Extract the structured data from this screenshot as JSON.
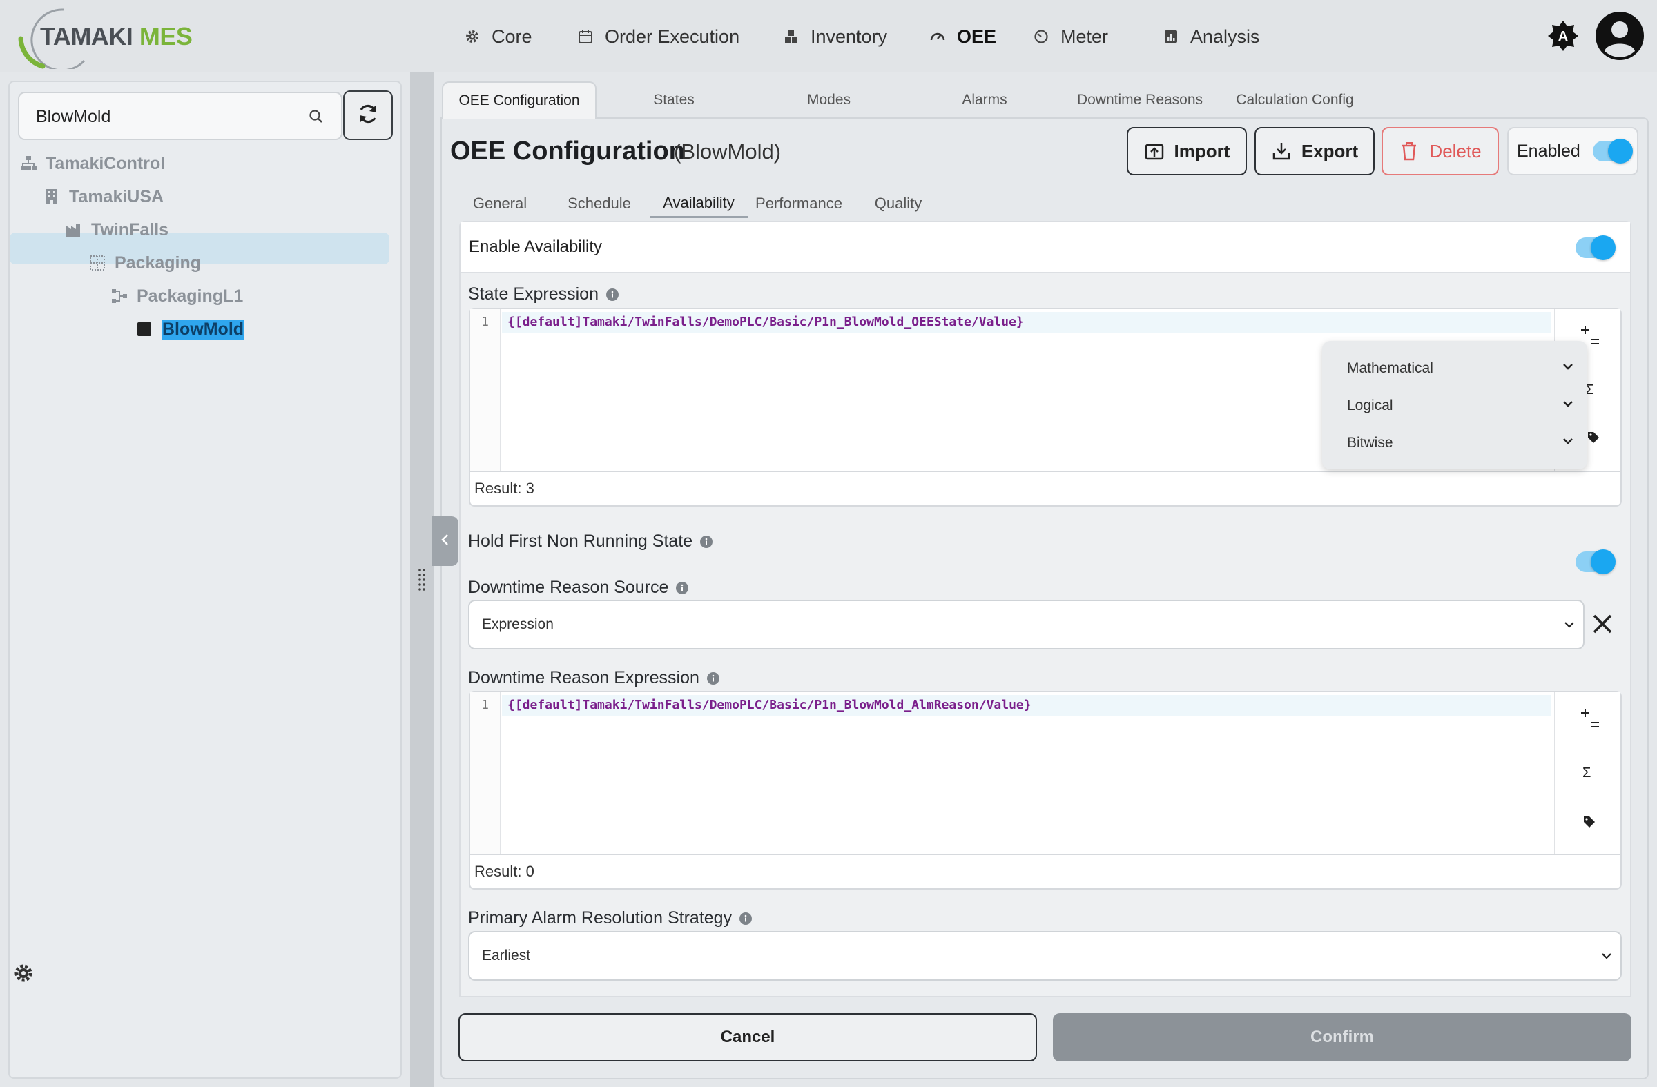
{
  "logo": {
    "part1": "TAMAKI",
    "part2": "MES"
  },
  "nav": [
    {
      "label": "Core",
      "icon": "gear-icon"
    },
    {
      "label": "Order Execution",
      "icon": "calendar-icon"
    },
    {
      "label": "Inventory",
      "icon": "boxes-icon"
    },
    {
      "label": "OEE",
      "icon": "gauge-icon"
    },
    {
      "label": "Meter",
      "icon": "dial-icon"
    },
    {
      "label": "Analysis",
      "icon": "chart-icon"
    }
  ],
  "active_nav": "OEE",
  "user_menu": {
    "theme_icon": "theme-auto-icon",
    "theme_letter": "A",
    "avatar_icon": "user-avatar-icon"
  },
  "sidebar": {
    "search": {
      "value": "BlowMold",
      "placeholder": "Search"
    },
    "tree": [
      {
        "label": "TamakiControl",
        "icon": "hierarchy-icon"
      },
      {
        "label": "TamakiUSA",
        "icon": "building-icon"
      },
      {
        "label": "TwinFalls",
        "icon": "factory-icon"
      },
      {
        "label": "Packaging",
        "icon": "grid-area-icon"
      },
      {
        "label": "PackagingL1",
        "icon": "line-icon"
      },
      {
        "label": "BlowMold",
        "icon": "cell-icon",
        "selected": true
      }
    ]
  },
  "tabs": [
    "OEE Configuration",
    "States",
    "Modes",
    "Alarms",
    "Downtime Reasons",
    "Calculation Config"
  ],
  "header": {
    "title": "OEE Configuration",
    "subtitle": "(BlowMold)",
    "import_label": "Import",
    "export_label": "Export",
    "delete_label": "Delete",
    "enabled_label": "Enabled",
    "enabled": true
  },
  "subtabs": [
    "General",
    "Schedule",
    "Availability",
    "Performance",
    "Quality"
  ],
  "active_subtab": "Availability",
  "availability": {
    "enable_label": "Enable Availability",
    "enabled": true,
    "state_expression": {
      "label": "State Expression",
      "line_number": "1",
      "code": "{[default]Tamaki/TwinFalls/DemoPLC/Basic/P1n_BlowMold_OEEState/Value}",
      "result": "Result: 3"
    },
    "operator_menu": [
      "Mathematical",
      "Logical",
      "Bitwise"
    ],
    "hold_label": "Hold First Non Running State",
    "hold_enabled": true,
    "downtime_source": {
      "label": "Downtime Reason Source",
      "value": "Expression"
    },
    "downtime_expression": {
      "label": "Downtime Reason Expression",
      "line_number": "1",
      "code": "{[default]Tamaki/TwinFalls/DemoPLC/Basic/P1n_BlowMold_AlmReason/Value}",
      "result": "Result: 0"
    },
    "alarm_strategy": {
      "label": "Primary Alarm Resolution Strategy",
      "value": "Earliest"
    }
  },
  "footer": {
    "cancel_label": "Cancel",
    "confirm_label": "Confirm"
  },
  "colors": {
    "accent": "#1aa7f1",
    "brand_green": "#7bb43a",
    "danger": "#e05a5a",
    "selected_bg": "#cfe3ee"
  }
}
